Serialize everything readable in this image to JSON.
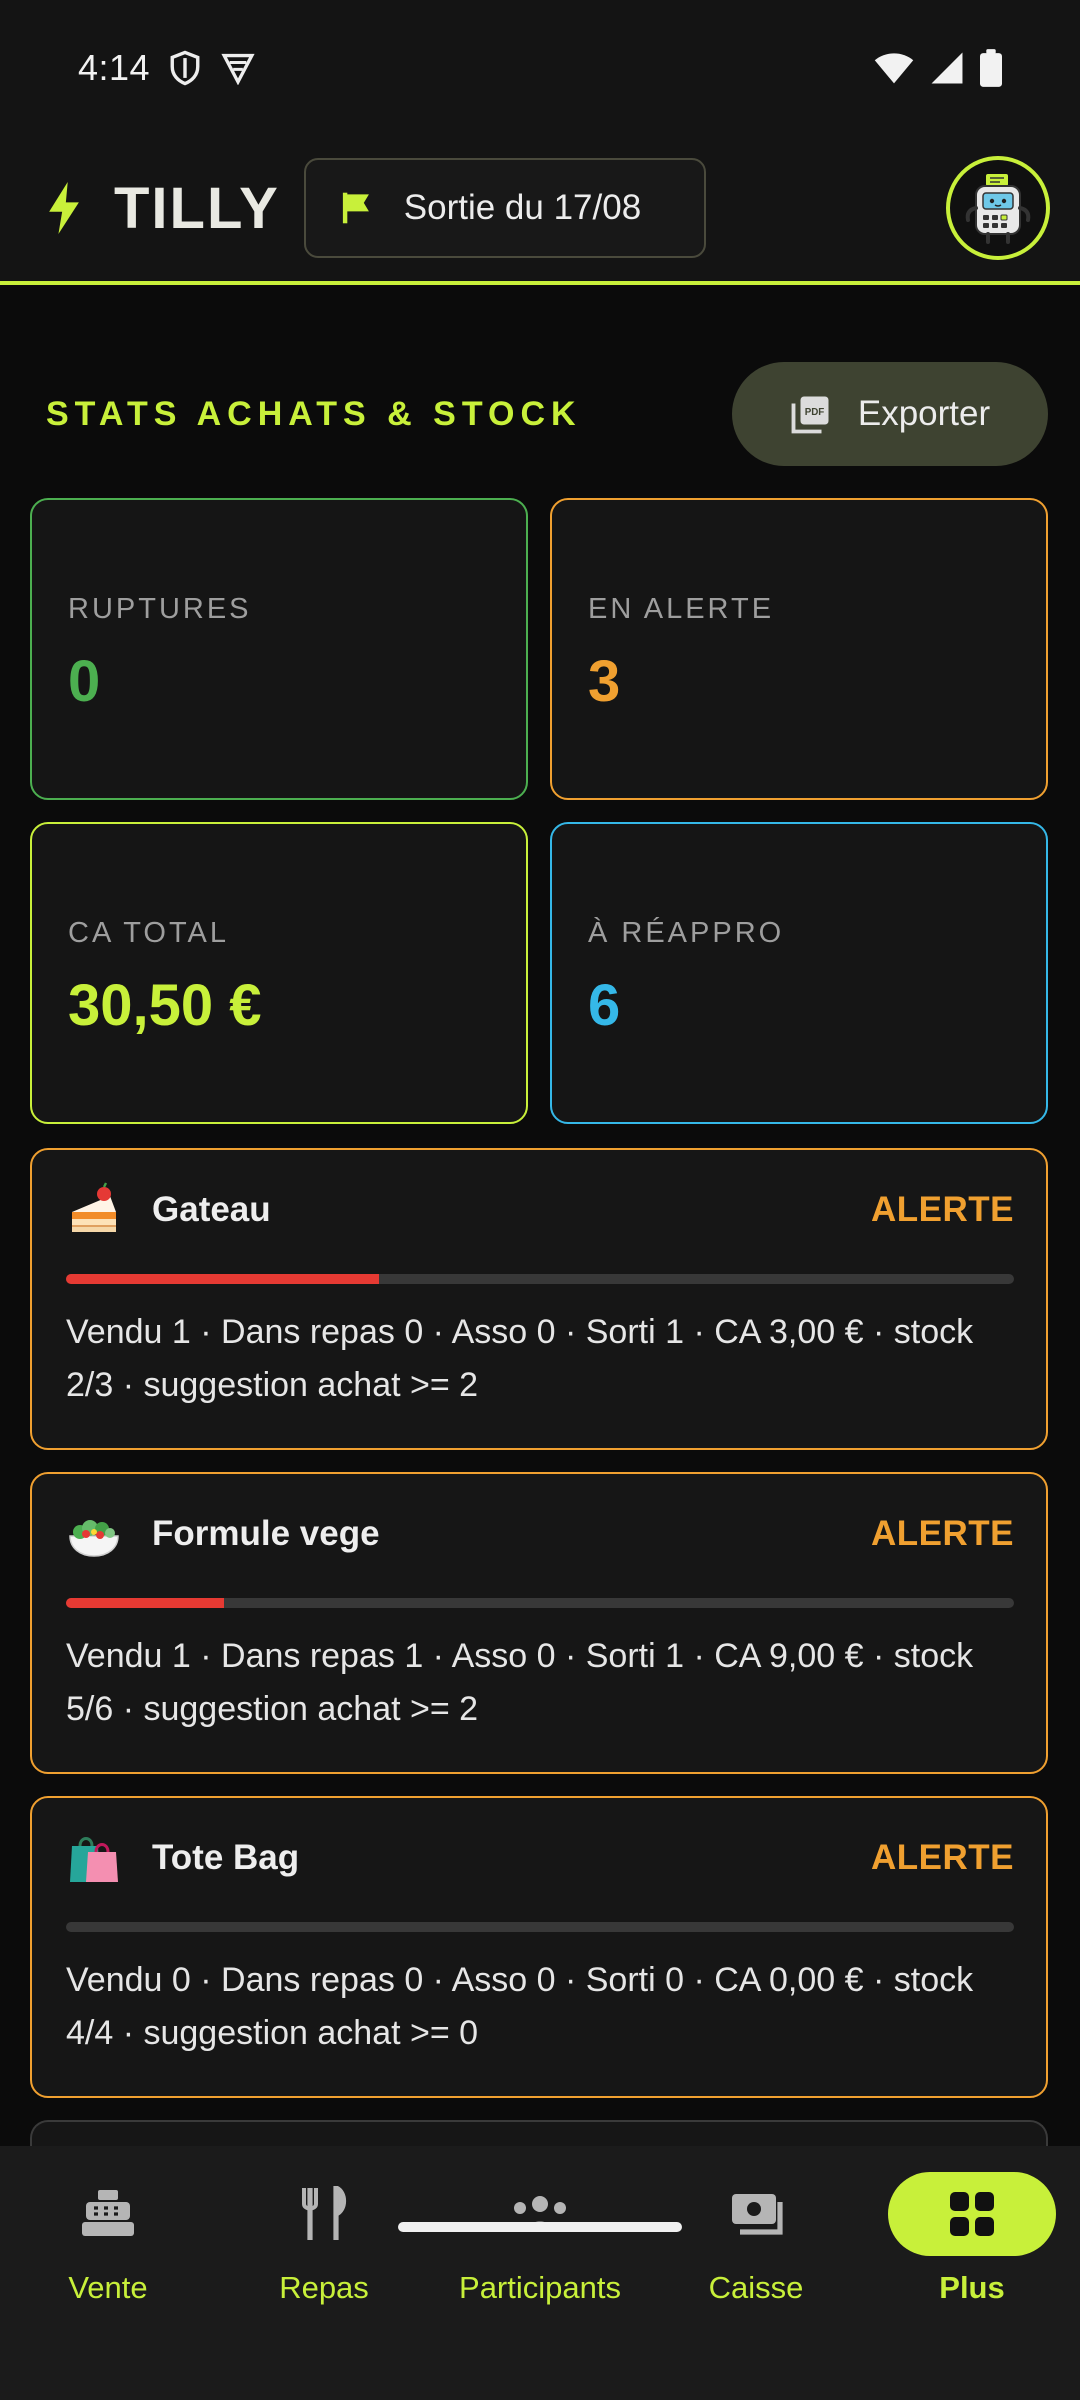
{
  "status_bar": {
    "time": "4:14"
  },
  "app_bar": {
    "title": "TILLY",
    "session_label": "Sortie du 17/08"
  },
  "section": {
    "title": "STATS ACHATS & STOCK",
    "export_label": "Exporter"
  },
  "stats": [
    {
      "label": "RUPTURES",
      "value": "0",
      "color": "#4caf50"
    },
    {
      "label": "EN ALERTE",
      "value": "3",
      "color": "#f0a030"
    },
    {
      "label": "CA TOTAL",
      "value": "30,50 €",
      "color": "#c8f03a"
    },
    {
      "label": "À RÉAPPRO",
      "value": "6",
      "color": "#35b8e8"
    }
  ],
  "products": [
    {
      "emoji": "cake-icon",
      "name": "Gateau",
      "status": "ALERTE",
      "progress_fraction": 0.33,
      "details": "Vendu 1 · Dans repas 0 · Asso 0 · Sorti 1 · CA 3,00 € · stock 2/3 · suggestion achat >= 2"
    },
    {
      "emoji": "salad-icon",
      "name": "Formule vege",
      "status": "ALERTE",
      "progress_fraction": 0.167,
      "details": "Vendu 1 · Dans repas 1 · Asso 0 · Sorti 1 · CA 9,00 € · stock 5/6 · suggestion achat >= 2"
    },
    {
      "emoji": "shopping-bag-icon",
      "name": "Tote Bag",
      "status": "ALERTE",
      "progress_fraction": 0.0,
      "details": "Vendu 0 · Dans repas 0 · Asso 0 · Sorti 0 · CA 0,00 € · stock 4/4 · suggestion achat >= 0"
    }
  ],
  "nav": {
    "items": [
      {
        "label": "Vente",
        "icon": "cash-register-icon"
      },
      {
        "label": "Repas",
        "icon": "fork-knife-icon"
      },
      {
        "label": "Participants",
        "icon": "people-icon"
      },
      {
        "label": "Caisse",
        "icon": "cash-drawer-icon"
      },
      {
        "label": "Plus",
        "icon": "grid-icon",
        "active": true
      }
    ]
  },
  "colors": {
    "accent": "#c8f03a",
    "alert": "#f0a030",
    "danger": "#e63a33",
    "background": "#0b0b0b"
  }
}
